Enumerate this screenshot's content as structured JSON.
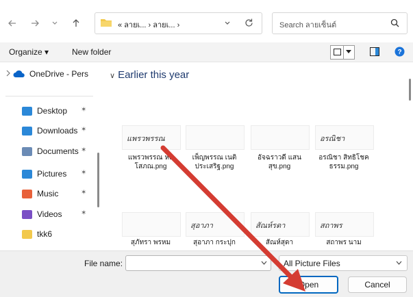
{
  "address": {
    "path_text": "« ลายเ... › ลายเ... ›",
    "search_placeholder": "Search ลายเซ็นต์"
  },
  "toolbar": {
    "organize_label": "Organize ▾",
    "new_folder_label": "New folder"
  },
  "sidebar": {
    "onedrive_label": "OneDrive - Pers",
    "items": [
      {
        "label": "Desktop",
        "color": "#2b88d8"
      },
      {
        "label": "Downloads",
        "color": "#2b88d8"
      },
      {
        "label": "Documents",
        "color": "#6b8bb5"
      },
      {
        "label": "Pictures",
        "color": "#2b88d8"
      },
      {
        "label": "Music",
        "color": "#e8613a"
      },
      {
        "label": "Videos",
        "color": "#7a4fc5"
      },
      {
        "label": "tkk6",
        "color": "#f2c94c"
      }
    ]
  },
  "content": {
    "group_header": "Earlier this year",
    "files": [
      {
        "name": "แพรวพรรณ หลิ\nโสภณ.png",
        "signature": "แพรวพรรณ"
      },
      {
        "name": "เพ็ญพรรณ เนติ\nประเสริฐ.png",
        "signature": ""
      },
      {
        "name": "อัจฉราวดี แสน\nสุข.png",
        "signature": ""
      },
      {
        "name": "อรณิชา สิทธิโชค\nธรรม.png",
        "signature": "อรณิชา"
      },
      {
        "name": "สุภัทรา พรหม",
        "signature": ""
      },
      {
        "name": "สุอาภา กระปุก",
        "signature": "สุอาภา"
      },
      {
        "name": "สัณห์สุดา",
        "signature": "สัณห์รดา"
      },
      {
        "name": "สถาพร นาม",
        "signature": "สถาพร"
      }
    ]
  },
  "footer": {
    "filename_label": "File name:",
    "filename_value": "",
    "filter_value": "All Picture Files",
    "open_label": "Open",
    "cancel_label": "Cancel"
  }
}
